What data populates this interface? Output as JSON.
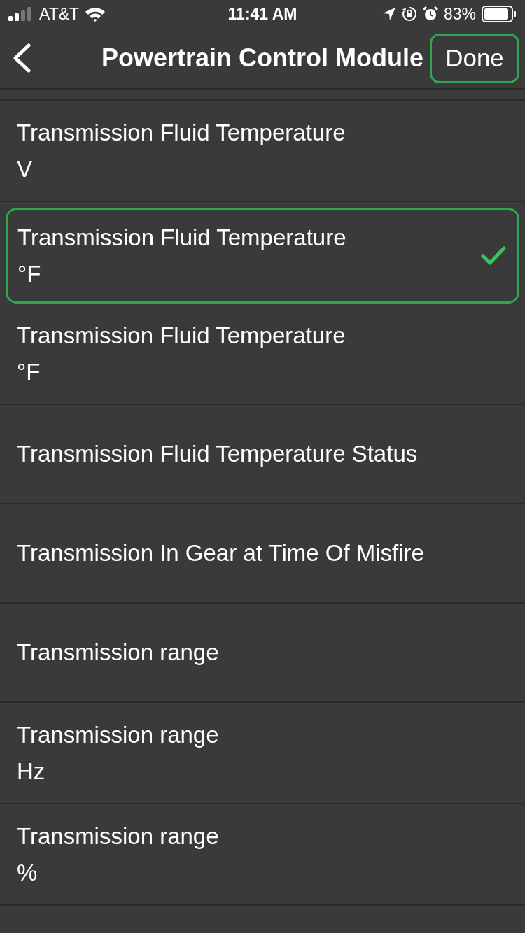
{
  "status_bar": {
    "carrier": "AT&T",
    "time": "11:41 AM",
    "battery_percent": "83%"
  },
  "nav_bar": {
    "title": "Powertrain Control Module",
    "done": {
      "label": "Done",
      "highlighted": true
    }
  },
  "rows": [
    {
      "title": "Transmission Fluid Temperature",
      "unit": "V",
      "selected": false
    },
    {
      "title": "Transmission Fluid Temperature",
      "unit": "°F",
      "selected": true
    },
    {
      "title": "Transmission Fluid Temperature",
      "unit": "°F",
      "selected": false
    },
    {
      "title": "Transmission Fluid Temperature Status",
      "selected": false
    },
    {
      "title": "Transmission In Gear at Time Of Misfire",
      "selected": false
    },
    {
      "title": "Transmission range",
      "selected": false
    },
    {
      "title": "Transmission range",
      "unit": "Hz",
      "selected": false
    },
    {
      "title": "Transmission range",
      "unit": "%",
      "selected": false
    }
  ]
}
